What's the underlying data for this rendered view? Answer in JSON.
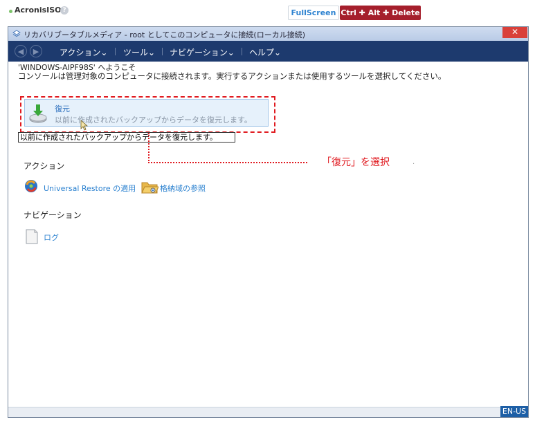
{
  "app": {
    "name": "AcronisISO",
    "help_icon": "?",
    "fullscreen_label": "FullScreen",
    "cad_label": "Ctrl ✚ Alt ✚ Delete"
  },
  "window": {
    "title": "リカバリブータブルメディア - root としてこのコンピュータに接続(ローカル接続)",
    "close_label": "✕"
  },
  "nav": {
    "back_icon": "back-arrow-icon",
    "forward_icon": "forward-arrow-icon",
    "menus": [
      "アクション⌄",
      "ツール⌄",
      "ナビゲーション⌄",
      "ヘルプ⌄"
    ]
  },
  "content": {
    "welcome": "'WINDOWS-AIPF98S' へようこそ",
    "description": "コンソールは管理対象のコンピュータに接続されます。実行するアクションまたは使用するツールを選択してください。",
    "restore": {
      "title": "復元",
      "subtitle": "以前に作成されたバックアップからデータを復元します。"
    },
    "tooltip": "以前に作成されたバックアップからデータを復元します。",
    "callout": "「復元」を選択",
    "actions_heading": "アクション",
    "actions": [
      {
        "label": "Universal Restore の適用",
        "icon": "universal-restore-icon"
      },
      {
        "label": "格納域の参照",
        "icon": "folder-browse-icon"
      }
    ],
    "navigation_heading": "ナビゲーション",
    "navigation": [
      {
        "label": "ログ",
        "icon": "log-document-icon"
      }
    ]
  },
  "status": {
    "language": "EN-US"
  },
  "colors": {
    "nav_background": "#1d3a6e",
    "accent_red": "#e0191f",
    "cad_button": "#a51f2c",
    "link": "#2c82d0"
  }
}
